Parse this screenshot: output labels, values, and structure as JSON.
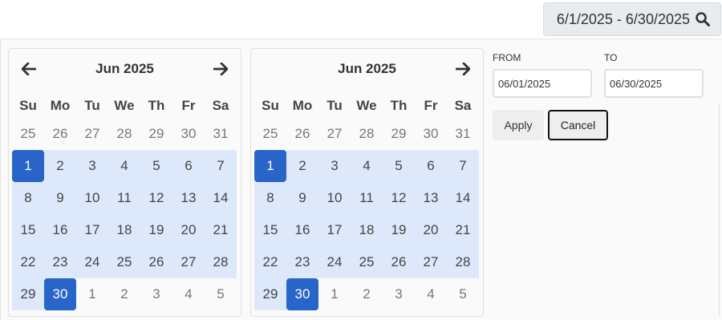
{
  "trigger": {
    "text": "6/1/2025 - 6/30/2025",
    "icon": "search-icon"
  },
  "calendars": [
    {
      "month_label": "Jun 2025",
      "show_prev": true,
      "show_next": true,
      "weekdays": [
        "Su",
        "Mo",
        "Tu",
        "We",
        "Th",
        "Fr",
        "Sa"
      ],
      "weeks": [
        [
          "25",
          "26",
          "27",
          "28",
          "29",
          "30",
          "31"
        ],
        [
          "1",
          "2",
          "3",
          "4",
          "5",
          "6",
          "7"
        ],
        [
          "8",
          "9",
          "10",
          "11",
          "12",
          "13",
          "14"
        ],
        [
          "15",
          "16",
          "17",
          "18",
          "19",
          "20",
          "21"
        ],
        [
          "22",
          "23",
          "24",
          "25",
          "26",
          "27",
          "28"
        ],
        [
          "29",
          "30",
          "1",
          "2",
          "3",
          "4",
          "5"
        ]
      ]
    },
    {
      "month_label": "Jun 2025",
      "show_prev": false,
      "show_next": true,
      "weekdays": [
        "Su",
        "Mo",
        "Tu",
        "We",
        "Th",
        "Fr",
        "Sa"
      ],
      "weeks": [
        [
          "25",
          "26",
          "27",
          "28",
          "29",
          "30",
          "31"
        ],
        [
          "1",
          "2",
          "3",
          "4",
          "5",
          "6",
          "7"
        ],
        [
          "8",
          "9",
          "10",
          "11",
          "12",
          "13",
          "14"
        ],
        [
          "15",
          "16",
          "17",
          "18",
          "19",
          "20",
          "21"
        ],
        [
          "22",
          "23",
          "24",
          "25",
          "26",
          "27",
          "28"
        ],
        [
          "29",
          "30",
          "1",
          "2",
          "3",
          "4",
          "5"
        ]
      ]
    }
  ],
  "range": {
    "start": "1",
    "end": "30"
  },
  "from": {
    "label": "FROM",
    "value": "06/01/2025"
  },
  "to": {
    "label": "TO",
    "value": "06/30/2025"
  },
  "buttons": {
    "apply": "Apply",
    "cancel": "Cancel"
  },
  "colors": {
    "accent": "#2965c9",
    "range": "#dde9fb",
    "trigger_bg": "#e9ecef"
  }
}
